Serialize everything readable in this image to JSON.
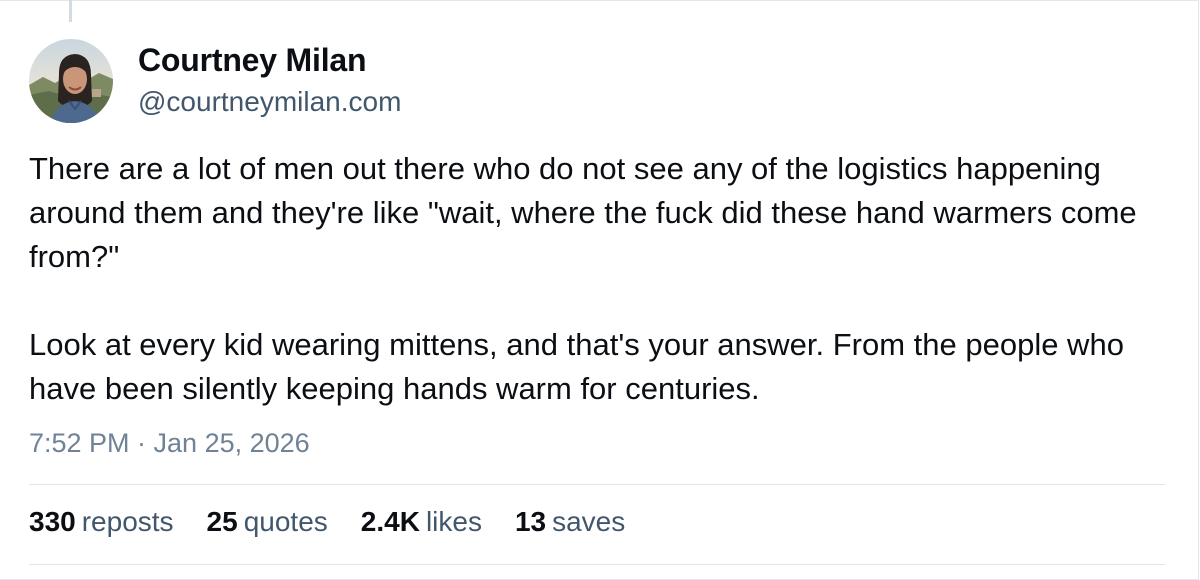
{
  "author": {
    "display_name": "Courtney Milan",
    "handle": "@courtneymilan.com"
  },
  "post": {
    "paragraphs": [
      "There are a lot of men out there who do not see any of the logistics happening around them and they're like \"wait, where the fuck did these hand warmers come from?\"",
      "Look at every kid wearing mittens, and that's your answer. From the people who have been silently keeping hands warm for centuries."
    ],
    "timestamp": "7:52 PM · Jan 25, 2026"
  },
  "stats": {
    "reposts": {
      "count": "330",
      "label": "reposts"
    },
    "quotes": {
      "count": "25",
      "label": "quotes"
    },
    "likes": {
      "count": "2.4K",
      "label": "likes"
    },
    "saves": {
      "count": "13",
      "label": "saves"
    }
  },
  "colors": {
    "text_primary": "#0b0f14",
    "text_secondary": "#42576c",
    "text_muted": "#6f8296",
    "divider": "#e3e7ec"
  }
}
